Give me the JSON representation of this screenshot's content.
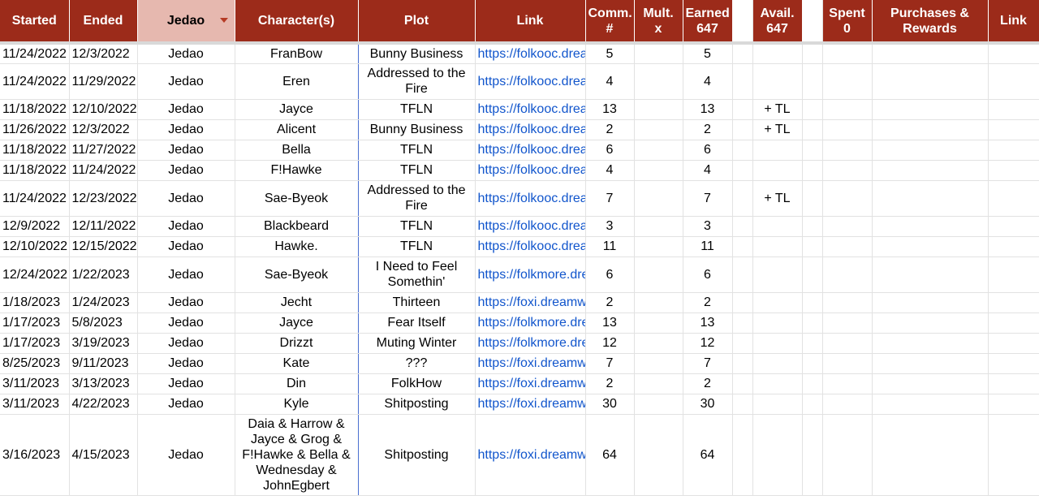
{
  "headers": {
    "started": "Started",
    "ended": "Ended",
    "jedao": "Jedao",
    "characters": "Character(s)",
    "plot": "Plot",
    "link": "Link",
    "comm_line1": "Comm.",
    "comm_line2": "#",
    "mult_line1": "Mult.",
    "mult_line2": "x",
    "earned_line1": "Earned",
    "earned_line2": "647",
    "avail_line1": "Avail.",
    "avail_line2": "647",
    "spent_line1": "Spent",
    "spent_line2": "0",
    "purchases": "Purchases & Rewards",
    "link2": "Link"
  },
  "colors": {
    "header_bg": "#9c2b1a",
    "filter_bg": "#e6b8af",
    "link": "#1155cc"
  },
  "rows": [
    {
      "started": "11/24/2022",
      "ended": "12/3/2022",
      "jedao": "Jedao",
      "chars": "FranBow",
      "plot": "Bunny Business",
      "link": "https://folkooc.drea",
      "comm": "5",
      "mult": "",
      "earned": "5",
      "avail": "",
      "h": "h25"
    },
    {
      "started": "11/24/2022",
      "ended": "11/29/2022",
      "jedao": "Jedao",
      "chars": "Eren",
      "plot": "Addressed to the Fire",
      "link": "https://folkooc.drea",
      "comm": "4",
      "mult": "",
      "earned": "4",
      "avail": "",
      "h": "h44"
    },
    {
      "started": "11/18/2022",
      "ended": "12/10/2022",
      "jedao": "Jedao",
      "chars": "Jayce",
      "plot": "TFLN",
      "link": "https://folkooc.drea",
      "comm": "13",
      "mult": "",
      "earned": "13",
      "avail": "+ TL",
      "h": "h25"
    },
    {
      "started": "11/26/2022",
      "ended": "12/3/2022",
      "jedao": "Jedao",
      "chars": "Alicent",
      "plot": "Bunny Business",
      "link": "https://folkooc.drea",
      "comm": "2",
      "mult": "",
      "earned": "2",
      "avail": "+ TL",
      "h": "h25"
    },
    {
      "started": "11/18/2022",
      "ended": "11/27/2022",
      "jedao": "Jedao",
      "chars": "Bella",
      "plot": "TFLN",
      "link": "https://folkooc.drea",
      "comm": "6",
      "mult": "",
      "earned": "6",
      "avail": "",
      "h": "h25"
    },
    {
      "started": "11/18/2022",
      "ended": "11/24/2022",
      "jedao": "Jedao",
      "chars": "F!Hawke",
      "plot": "TFLN",
      "link": "https://folkooc.drea",
      "comm": "4",
      "mult": "",
      "earned": "4",
      "avail": "",
      "h": "h25"
    },
    {
      "started": "11/24/2022",
      "ended": "12/23/2022",
      "jedao": "Jedao",
      "chars": "Sae-Byeok",
      "plot": "Addressed to the Fire",
      "link": "https://folkooc.drea",
      "comm": "7",
      "mult": "",
      "earned": "7",
      "avail": "+ TL",
      "h": "h44"
    },
    {
      "started": "12/9/2022",
      "ended": "12/11/2022",
      "jedao": "Jedao",
      "chars": "Blackbeard",
      "plot": "TFLN",
      "link": "https://folkooc.drea",
      "comm": "3",
      "mult": "",
      "earned": "3",
      "avail": "",
      "h": "h25"
    },
    {
      "started": "12/10/2022",
      "ended": "12/15/2022",
      "jedao": "Jedao",
      "chars": "Hawke.",
      "plot": "TFLN",
      "link": "https://folkooc.drea",
      "comm": "11",
      "mult": "",
      "earned": "11",
      "avail": "",
      "h": "h25"
    },
    {
      "started": "12/24/2022",
      "ended": "1/22/2023",
      "jedao": "Jedao",
      "chars": "Sae-Byeok",
      "plot": "I Need to Feel Somethin'",
      "link": "https://folkmore.dre",
      "comm": "6",
      "mult": "",
      "earned": "6",
      "avail": "",
      "h": "h44"
    },
    {
      "started": "1/18/2023",
      "ended": "1/24/2023",
      "jedao": "Jedao",
      "chars": "Jecht",
      "plot": "Thirteen",
      "link": "https://foxi.dreamw",
      "comm": "2",
      "mult": "",
      "earned": "2",
      "avail": "",
      "h": "h25"
    },
    {
      "started": "1/17/2023",
      "ended": "5/8/2023",
      "jedao": "Jedao",
      "chars": "Jayce",
      "plot": "Fear Itself",
      "link": "https://folkmore.dre",
      "comm": "13",
      "mult": "",
      "earned": "13",
      "avail": "",
      "h": "h25"
    },
    {
      "started": "1/17/2023",
      "ended": "3/19/2023",
      "jedao": "Jedao",
      "chars": "Drizzt",
      "plot": "Muting Winter",
      "link": "https://folkmore.dre",
      "comm": "12",
      "mult": "",
      "earned": "12",
      "avail": "",
      "h": "h25"
    },
    {
      "started": "8/25/2023",
      "ended": "9/11/2023",
      "jedao": "Jedao",
      "chars": "Kate",
      "plot": "???",
      "link": "https://foxi.dreamw",
      "comm": "7",
      "mult": "",
      "earned": "7",
      "avail": "",
      "h": "h25"
    },
    {
      "started": "3/11/2023",
      "ended": "3/13/2023",
      "jedao": "Jedao",
      "chars": "Din",
      "plot": "FolkHow",
      "link": "https://foxi.dreamw",
      "comm": "2",
      "mult": "",
      "earned": "2",
      "avail": "",
      "h": "h25"
    },
    {
      "started": "3/11/2023",
      "ended": "4/22/2023",
      "jedao": "Jedao",
      "chars": "Kyle",
      "plot": "Shitposting",
      "link": "https://foxi.dreamw",
      "comm": "30",
      "mult": "",
      "earned": "30",
      "avail": "",
      "h": "h25"
    },
    {
      "started": "3/16/2023",
      "ended": "4/15/2023",
      "jedao": "Jedao",
      "chars": "Daia & Harrow & Jayce & Grog & F!Hawke & Bella & Wednesday & JohnEgbert",
      "plot": "Shitposting",
      "link": "https://foxi.dreamw",
      "comm": "64",
      "mult": "",
      "earned": "64",
      "avail": "",
      "h": "h100"
    }
  ]
}
